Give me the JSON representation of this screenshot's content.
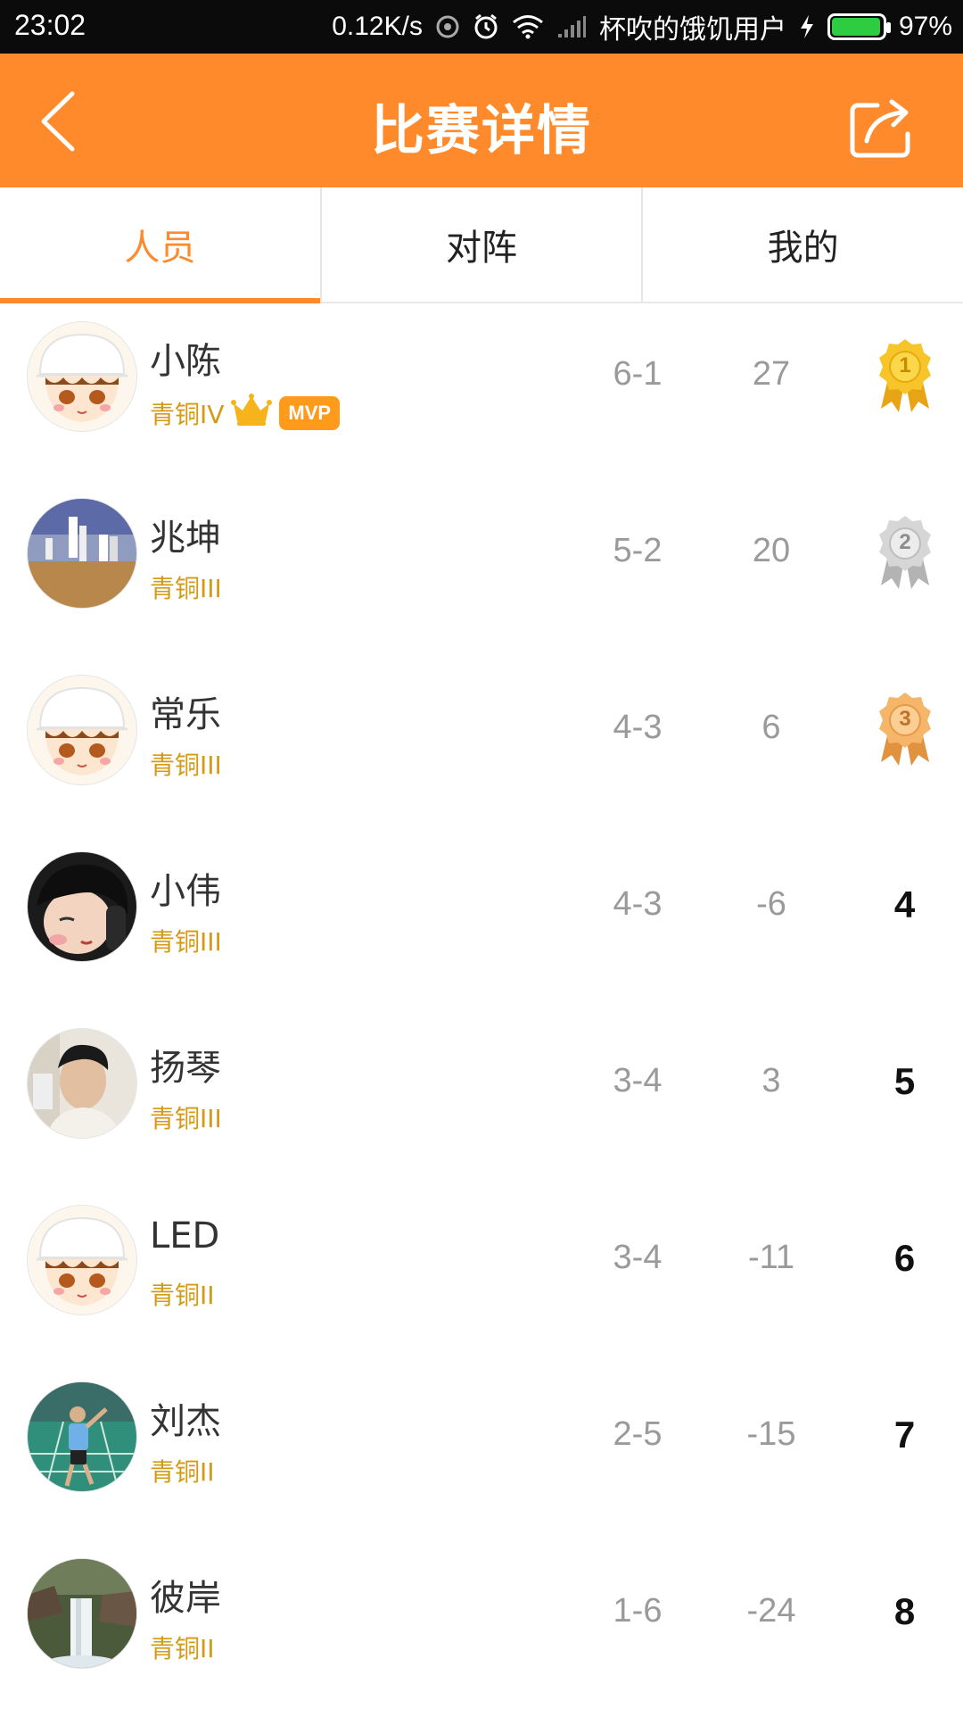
{
  "status_bar": {
    "time": "23:02",
    "speed": "0.12K/s",
    "carrier": "杯吹的饿饥用户",
    "battery": "97%",
    "icons": [
      "hotspot-icon",
      "alarm-icon",
      "wifi-icon",
      "signal-icon",
      "charging-icon",
      "battery-icon"
    ]
  },
  "header": {
    "title": "比赛详情",
    "back_icon": "chevron-left-icon",
    "share_icon": "share-icon"
  },
  "tabs": [
    {
      "label": "人员",
      "active": true
    },
    {
      "label": "对阵",
      "active": false
    },
    {
      "label": "我的",
      "active": false
    }
  ],
  "colors": {
    "accent": "#ff8a2b",
    "level": "#d49a15",
    "gold": "#f7c52a",
    "silver": "#c9c9c9",
    "bronze": "#f5b66a"
  },
  "players": [
    {
      "name": "小陈",
      "level": "青铜IV",
      "badges": [
        "crown-icon",
        "MVP"
      ],
      "record": "6-1",
      "score": "27",
      "rank": "1",
      "medal": "gold",
      "avatar": "cartoon-cap"
    },
    {
      "name": "兆坤",
      "level": "青铜III",
      "badges": [],
      "record": "5-2",
      "score": "20",
      "rank": "2",
      "medal": "silver",
      "avatar": "photo-court"
    },
    {
      "name": "常乐",
      "level": "青铜III",
      "badges": [],
      "record": "4-3",
      "score": "6",
      "rank": "3",
      "medal": "bronze",
      "avatar": "cartoon-cap"
    },
    {
      "name": "小伟",
      "level": "青铜III",
      "badges": [],
      "record": "4-3",
      "score": "-6",
      "rank": "4",
      "medal": "",
      "avatar": "photo-dark"
    },
    {
      "name": "扬琴",
      "level": "青铜III",
      "badges": [],
      "record": "3-4",
      "score": "3",
      "rank": "5",
      "medal": "",
      "avatar": "photo-face"
    },
    {
      "name": "LED",
      "level": "青铜II",
      "badges": [],
      "record": "3-4",
      "score": "-11",
      "rank": "6",
      "medal": "",
      "avatar": "cartoon-cap"
    },
    {
      "name": "刘杰",
      "level": "青铜II",
      "badges": [],
      "record": "2-5",
      "score": "-15",
      "rank": "7",
      "medal": "",
      "avatar": "photo-green"
    },
    {
      "name": "彼岸",
      "level": "青铜II",
      "badges": [],
      "record": "1-6",
      "score": "-24",
      "rank": "8",
      "medal": "",
      "avatar": "photo-waterfall"
    }
  ],
  "mvp_label": "MVP"
}
